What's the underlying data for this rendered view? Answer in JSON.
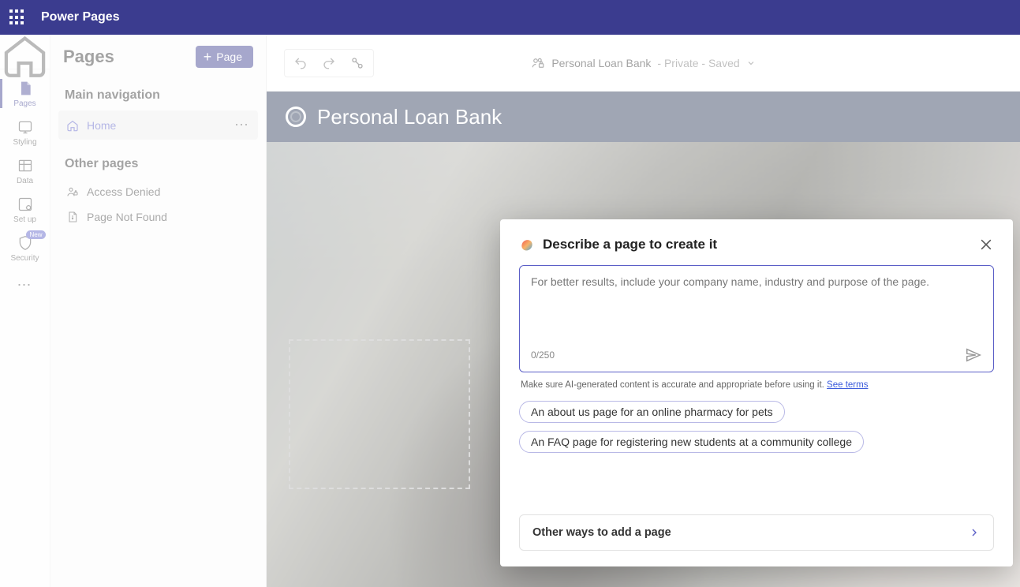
{
  "app": {
    "title": "Power Pages"
  },
  "rail": {
    "items": [
      {
        "label": "Pages"
      },
      {
        "label": "Styling"
      },
      {
        "label": "Data"
      },
      {
        "label": "Set up"
      },
      {
        "label": "Security",
        "badge": "New"
      }
    ]
  },
  "panel": {
    "title": "Pages",
    "add_page": "Page",
    "sections": {
      "main_nav": "Main navigation",
      "other": "Other pages"
    },
    "main_items": [
      {
        "label": "Home"
      }
    ],
    "other_items": [
      {
        "label": "Access Denied"
      },
      {
        "label": "Page Not Found"
      }
    ]
  },
  "status": {
    "site_name": "Personal Loan Bank",
    "suffix": " - Private - Saved"
  },
  "site": {
    "header_title": "Personal Loan Bank"
  },
  "dialog": {
    "title": "Describe a page to create it",
    "placeholder": "For better results, include your company name, industry and purpose of the page.",
    "counter": "0/250",
    "disclaimer_text": "Make sure AI-generated content is accurate and appropriate before using it. ",
    "terms_link": "See terms",
    "suggestions": [
      "An about us page for an online pharmacy for pets",
      "An FAQ page for registering new students at a community college"
    ],
    "other_ways": "Other ways to add a page"
  }
}
